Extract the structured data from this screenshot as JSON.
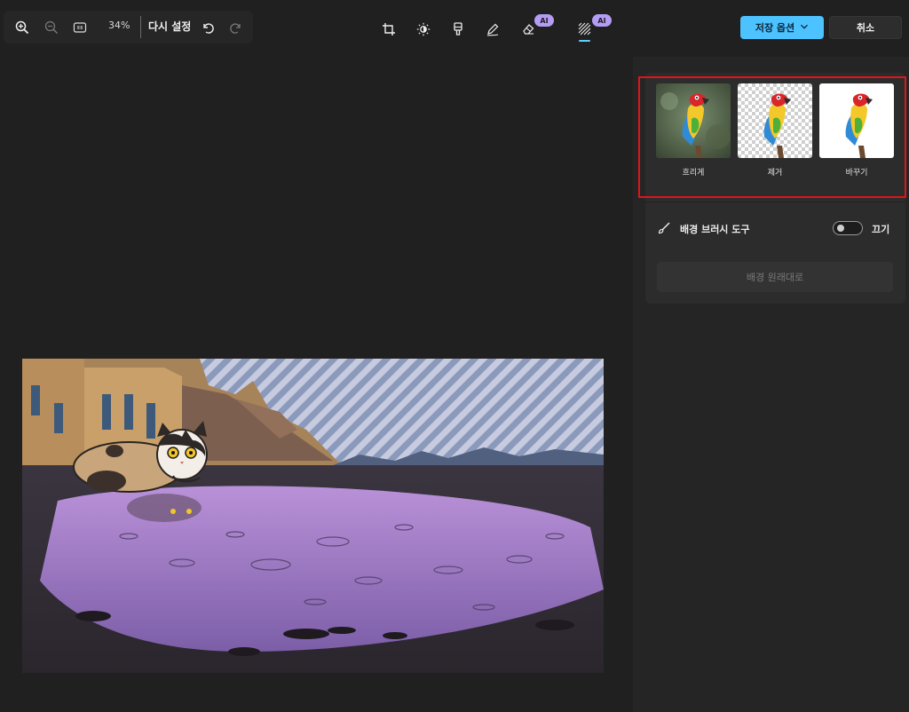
{
  "toolbar": {
    "zoom_percent": "34%",
    "reset_label": "다시 설정",
    "icons": [
      "zoom-in-icon",
      "zoom-out-icon",
      "actual-size-icon",
      "undo-icon",
      "redo-icon"
    ]
  },
  "tools": {
    "items": [
      "crop",
      "adjust",
      "filter",
      "markup",
      "erase",
      "background"
    ],
    "ai_badge": "AI",
    "active": "background"
  },
  "actions": {
    "save_label": "저장 옵션",
    "cancel_label": "취소"
  },
  "background_panel": {
    "options": [
      {
        "label": "흐리게"
      },
      {
        "label": "제거"
      },
      {
        "label": "바꾸기"
      }
    ],
    "brush_tool_label": "배경 브러시 도구",
    "toggle_state_label": "끄기",
    "toggle_on": false,
    "restore_label": "배경 원래대로"
  },
  "colors": {
    "accent": "#4cc2ff",
    "ai_badge": "#b49cf5",
    "highlight": "#e0141a",
    "background": "#202020",
    "panel": "#2c2c2c"
  }
}
